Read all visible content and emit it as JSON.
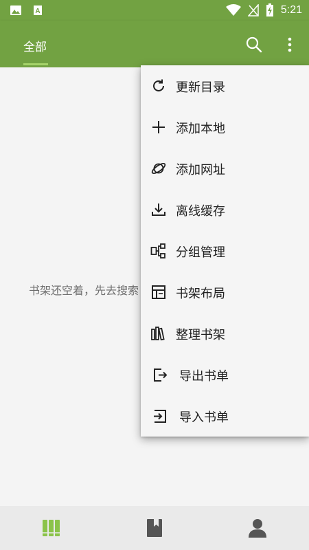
{
  "status_bar": {
    "time": "5:21",
    "icons": [
      "image-icon",
      "font-a-icon",
      "wifi-icon",
      "no-sim-icon",
      "battery-charging-icon"
    ]
  },
  "toolbar": {
    "tab_label": "全部",
    "search_icon": "search-icon",
    "more_icon": "more-vert-icon"
  },
  "main": {
    "empty_text": "书架还空着，先去搜索"
  },
  "menu": {
    "items": [
      {
        "label": "更新目录",
        "icon": "refresh-icon"
      },
      {
        "label": "添加本地",
        "icon": "plus-icon"
      },
      {
        "label": "添加网址",
        "icon": "planet-icon"
      },
      {
        "label": "离线缓存",
        "icon": "download-icon"
      },
      {
        "label": "分组管理",
        "icon": "group-icon"
      },
      {
        "label": "书架布局",
        "icon": "layout-icon"
      },
      {
        "label": "整理书架",
        "icon": "bookshelf-icon"
      },
      {
        "label": "导出书单",
        "icon": "export-icon"
      },
      {
        "label": "导入书单",
        "icon": "import-icon"
      }
    ]
  },
  "bottom_nav": {
    "items": [
      {
        "icon": "bookshelf-nav-icon",
        "active": true
      },
      {
        "icon": "book-nav-icon",
        "active": false
      },
      {
        "icon": "person-nav-icon",
        "active": false
      }
    ],
    "active_color": "#8bc34a",
    "inactive_color": "#555555"
  },
  "colors": {
    "primary": "#72a242",
    "tab_indicator": "#a5d26a"
  }
}
